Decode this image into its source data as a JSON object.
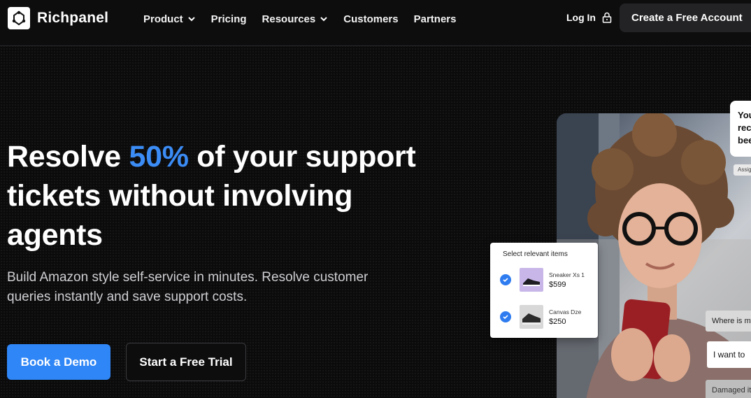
{
  "nav": {
    "brand": "Richpanel",
    "items": [
      {
        "label": "Product",
        "dropdown": true
      },
      {
        "label": "Pricing",
        "dropdown": false
      },
      {
        "label": "Resources",
        "dropdown": true
      },
      {
        "label": "Customers",
        "dropdown": false
      },
      {
        "label": "Partners",
        "dropdown": false
      }
    ],
    "login": "Log In",
    "cta": "Create a Free Account"
  },
  "hero": {
    "headline_pre": "Resolve ",
    "headline_accent": "50%",
    "headline_post": " of your support tickets without involving agents",
    "subheadline": "Build Amazon style self-service in minutes. Resolve customer queries instantly and save support costs.",
    "primary_button": "Book a Demo",
    "secondary_button": "Start a Free Trial"
  },
  "card": {
    "title": "Select relevant items",
    "items": [
      {
        "name": "Sneaker Xs 1",
        "price": "$599",
        "checked": true
      },
      {
        "name": "Canvas Dze",
        "price": "$250",
        "checked": true
      }
    ]
  },
  "chat": {
    "top_bubble_lines": [
      "You",
      "rec",
      "bee"
    ],
    "tag": "Assig",
    "pill_1": "Where is my",
    "pill_2": "I want to",
    "pill_3": "Damaged it"
  },
  "colors": {
    "accent": "#3b8cf5",
    "primary_button": "#2f86f6",
    "background": "#0b0b0c"
  }
}
